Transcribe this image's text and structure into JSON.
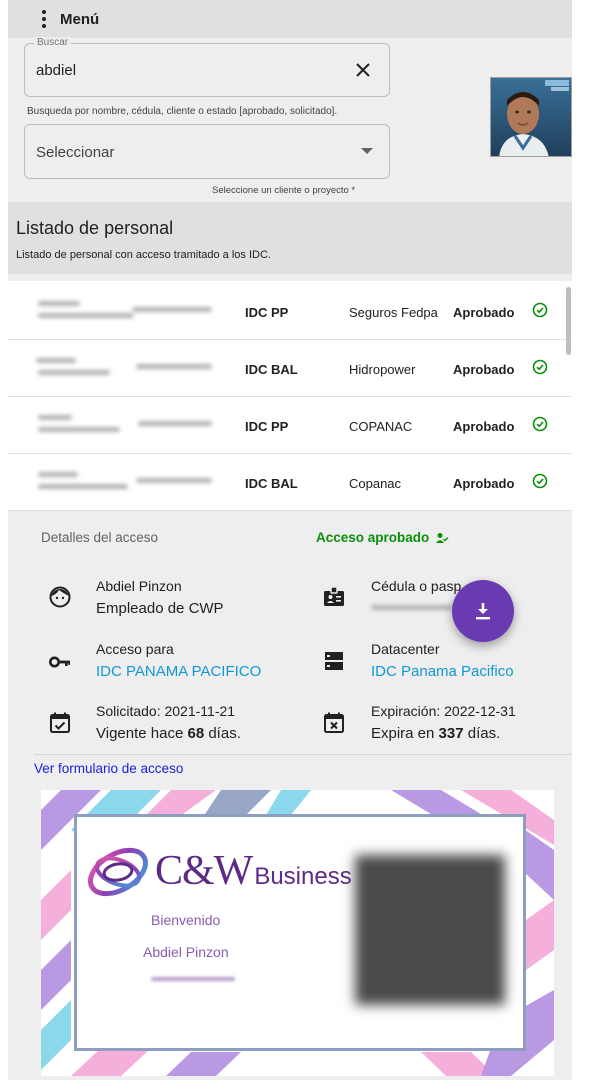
{
  "header": {
    "menu_label": "Menú"
  },
  "search": {
    "legend": "Buscar",
    "value": "abdiel",
    "helper": "Busqueda por nombre, cédula, cliente o estado [aprobado, solicitado].",
    "select_value": "Seleccionar",
    "select_hint": "Seleccione un cliente o proyecto *"
  },
  "listing": {
    "title": "Listado de personal",
    "subtitle": "Listado de personal con acceso tramitado a los IDC.",
    "rows": [
      {
        "site": "IDC PP",
        "client": "Seguros Fedpa",
        "status": "Aprobado"
      },
      {
        "site": "IDC BAL",
        "client": "Hidropower",
        "status": "Aprobado"
      },
      {
        "site": "IDC PP",
        "client": "COPANAC",
        "status": "Aprobado"
      },
      {
        "site": "IDC BAL",
        "client": "Copanac",
        "status": "Aprobado"
      }
    ]
  },
  "details": {
    "title": "Detalles del acceso",
    "approved": "Acceso aprobado",
    "name": "Abdiel Pinzon",
    "role": "Empleado de CWP",
    "cedula_label": "Cédula o pasp",
    "access_label": "Acceso para",
    "access_value": "IDC PANAMA PACIFICO",
    "datacenter_label": "Datacenter",
    "datacenter_value": "IDC Panama Pacifico",
    "requested_label": "Solicitado: 2021-11-21",
    "valid_prefix": "Vigente hace",
    "valid_days": "68",
    "valid_suffix": "días.",
    "expiry_label": "Expiración: 2022-12-31",
    "expire_prefix": "Expira en",
    "expire_days": "337",
    "expire_suffix": "días.",
    "form_link": "Ver formulario de acceso"
  },
  "badge": {
    "brand_main": "C&W",
    "brand_sub": "Business",
    "welcome": "Bienvenido",
    "name": "Abdiel Pinzon"
  },
  "colors": {
    "accent_purple": "#6a3ab2",
    "approved_green": "#0a8f0a",
    "link_blue": "#1098d6",
    "form_link_blue": "#1a22d6"
  },
  "icons": {
    "menu": "vertical-dots-icon",
    "clear": "close-icon",
    "approved": "check-circle-icon",
    "person": "face-icon",
    "id": "badge-icon",
    "access": "key-icon",
    "datacenter": "server-icon",
    "requested": "calendar-check-icon",
    "expiry": "calendar-x-icon",
    "download": "download-icon"
  }
}
